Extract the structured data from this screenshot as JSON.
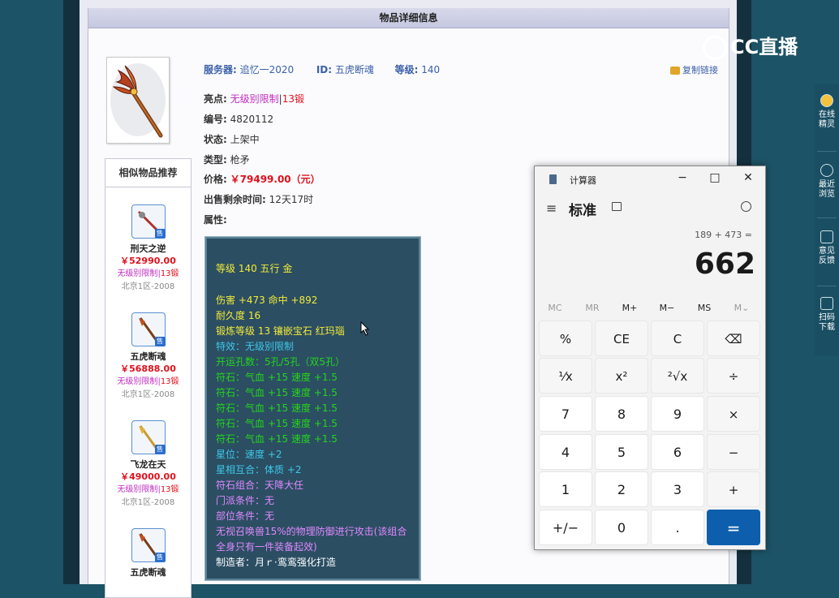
{
  "page": {
    "title": "物品详细信息",
    "server_label": "服务器:",
    "server_value": "追忆一2020",
    "id_label": "ID:",
    "id_value": "五虎断魂",
    "level_label": "等级:",
    "level_value": "140",
    "copy_link": "复制链接"
  },
  "item": {
    "highlight_label": "亮点:",
    "highlight_value": "无级别限制",
    "highlight_sep": "|",
    "highlight_value2": "13锻",
    "number_label": "编号:",
    "number_value": "4820112",
    "status_label": "状态:",
    "status_value": "上架中",
    "type_label": "类型:",
    "type_value": "枪矛",
    "price_label": "价格:",
    "price_value": "￥79499.00（元）",
    "remaining_label": "出售剩余时间:",
    "remaining_value": "12天17时",
    "attr_label": "属性:"
  },
  "stats": [
    "等级 140 五行 金",
    "伤害 +473 命中 +892",
    "耐久度 16",
    "锻炼等级 13 镶嵌宝石 红玛瑙",
    "特效：无级别限制",
    "开运孔数：5孔/5孔（双5孔）",
    "符石：气血 +15 速度 +1.5",
    "符石：气血 +15 速度 +1.5",
    "符石：气血 +15 速度 +1.5",
    "符石：气血 +15 速度 +1.5",
    "符石：气血 +15 速度 +1.5",
    "星位：速度 +2",
    "星相互合：体质 +2",
    "符石组合：天降大任",
    "门派条件：无",
    "部位条件：无",
    "无视召唤兽15%的物理防御进行攻击(该组合",
    "全身只有一件装备起效)",
    "制造者：月ｒ·鸾鸾强化打造"
  ],
  "similar": {
    "title": "相似物品推荐",
    "items": [
      {
        "name": "刑天之逆",
        "price": "￥52990.00",
        "tag": "无级别限制",
        "tag2": "13锻",
        "server": "北京1区-2008",
        "badge": "售"
      },
      {
        "name": "五虎断魂",
        "price": "￥56888.00",
        "tag": "无级别限制",
        "tag2": "13锻",
        "server": "北京1区-2008",
        "badge": "售"
      },
      {
        "name": "飞龙在天",
        "price": "￥49000.00",
        "tag": "无级别限制",
        "tag2": "13锻",
        "server": "北京1区-2008",
        "badge": "售"
      },
      {
        "name": "五虎断魂",
        "price": "",
        "tag": "",
        "tag2": "",
        "server": "",
        "badge": "售"
      }
    ]
  },
  "overlay": {
    "brand": "CC直播"
  },
  "sidebar": {
    "items": [
      {
        "label1": "在线",
        "label2": "精灵"
      },
      {
        "label1": "最近",
        "label2": "浏览"
      },
      {
        "label1": "意见",
        "label2": "反馈"
      },
      {
        "label1": "扫码",
        "label2": "下载"
      }
    ]
  },
  "calculator": {
    "window_title": "计算器",
    "min": "−",
    "max": "□",
    "close": "✕",
    "menu": "≡",
    "mode": "标准",
    "expression": "189 + 473 =",
    "display": "662",
    "memory": [
      "MC",
      "MR",
      "M+",
      "M−",
      "MS",
      "M⌄"
    ],
    "keys": [
      [
        "%",
        "CE",
        "C",
        "⌫"
      ],
      [
        "¹⁄x",
        "x²",
        "²√x",
        "÷"
      ],
      [
        "7",
        "8",
        "9",
        "×"
      ],
      [
        "4",
        "5",
        "6",
        "−"
      ],
      [
        "1",
        "2",
        "3",
        "+"
      ],
      [
        "+/−",
        "0",
        ".",
        "="
      ]
    ]
  }
}
